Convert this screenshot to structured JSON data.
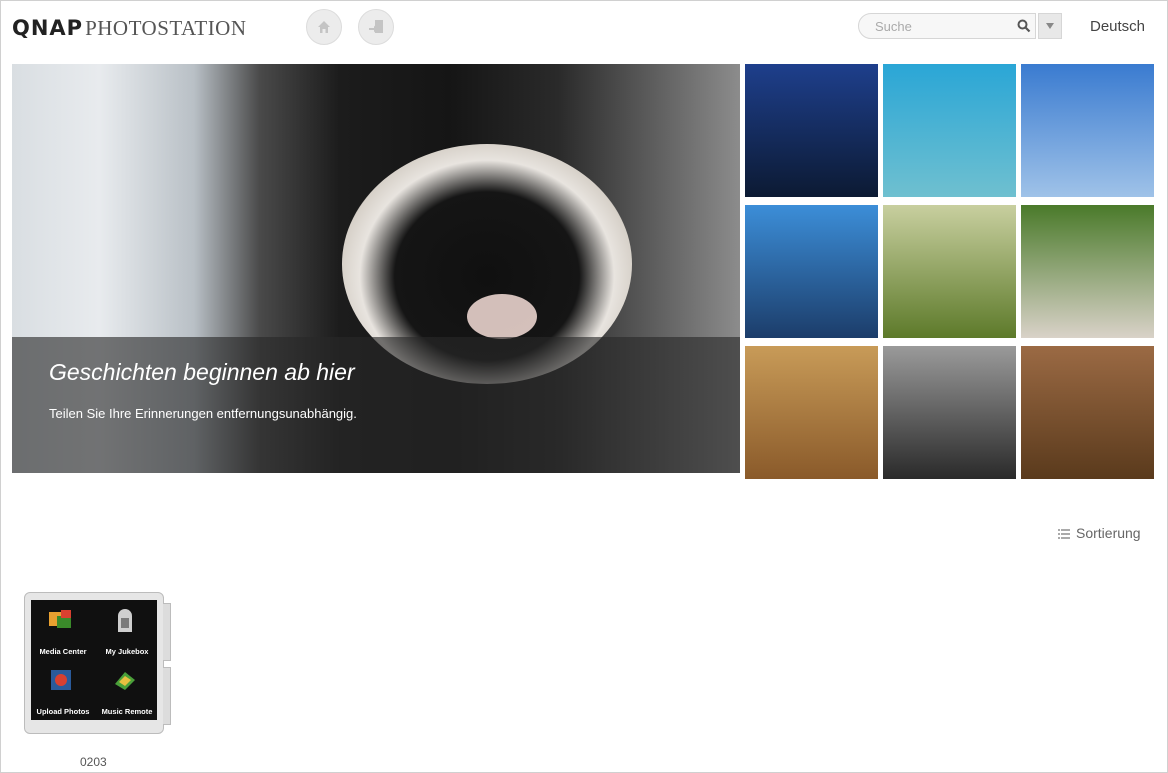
{
  "header": {
    "logo_brand": "QNAP",
    "logo_product": "PHOTOSTATION",
    "home_icon": "home-icon",
    "upload_icon": "upload-icon",
    "search": {
      "placeholder": "Suche"
    },
    "language": "Deutsch"
  },
  "hero": {
    "title": "Geschichten beginnen ab hier",
    "subtitle": "Teilen Sie Ihre Erinnerungen entfernungsunabhängig."
  },
  "thumbnails": [
    {
      "name": "city-skyline-photo",
      "top": "#1e3f8c",
      "bottom": "#0c1a33"
    },
    {
      "name": "bridge-sky-photo",
      "top": "#2aa6d6",
      "bottom": "#6fc0d0"
    },
    {
      "name": "tower-clouds-photo",
      "top": "#3a7bd0",
      "bottom": "#9fc2e8"
    },
    {
      "name": "harbor-photo",
      "top": "#3c8ed8",
      "bottom": "#1c3d6a"
    },
    {
      "name": "misty-field-photo",
      "top": "#c8cf9f",
      "bottom": "#5d7a2a"
    },
    {
      "name": "guinea-pig-photo",
      "top": "#4a7a2a",
      "bottom": "#d9d2c8"
    },
    {
      "name": "cat-photo",
      "top": "#c89b58",
      "bottom": "#8a5a2a"
    },
    {
      "name": "tree-path-photo",
      "top": "#9a9a9a",
      "bottom": "#2a2a2a"
    },
    {
      "name": "rock-texture-photo",
      "top": "#9b6a44",
      "bottom": "#5a3a1c"
    }
  ],
  "sort": {
    "label": "Sortierung",
    "icon": "list-icon"
  },
  "album": {
    "name": "0203",
    "apps": [
      {
        "label": "Media Center",
        "icon": "media-center-icon"
      },
      {
        "label": "My Jukebox",
        "icon": "jukebox-icon"
      },
      {
        "label": "Upload Photos",
        "icon": "upload-photos-icon"
      },
      {
        "label": "Music Remote",
        "icon": "music-remote-icon"
      }
    ]
  }
}
